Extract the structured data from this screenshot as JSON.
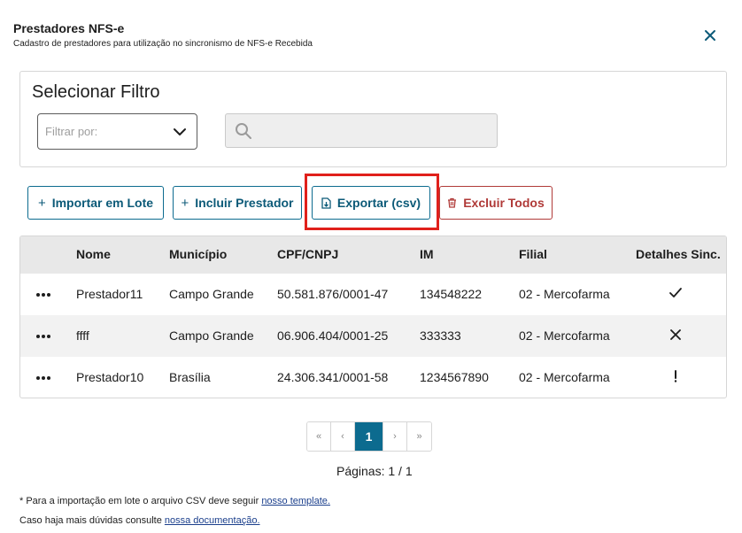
{
  "header": {
    "title": "Prestadores NFS-e",
    "subtitle": "Cadastro de prestadores para utilização no sincronismo de NFS-e Recebida",
    "close_icon": "close-icon"
  },
  "filter": {
    "title": "Selecionar Filtro",
    "select_placeholder": "Filtrar por:",
    "search_value": ""
  },
  "actions": {
    "import_label": "Importar em Lote",
    "include_label": "Incluir Prestador",
    "export_label": "Exportar (csv)",
    "delete_label": "Excluir Todos"
  },
  "table": {
    "headers": [
      "Nome",
      "Município",
      "CPF/CNPJ",
      "IM",
      "Filial",
      "Detalhes Sinc."
    ],
    "rows": [
      {
        "nome": "Prestador11",
        "municipio": "Campo Grande",
        "cnpj": "50.581.876/0001-47",
        "im": "134548222",
        "filial": "02 - Mercofarma",
        "status": "check"
      },
      {
        "nome": "ffff",
        "municipio": "Campo Grande",
        "cnpj": "06.906.404/0001-25",
        "im": "333333",
        "filial": "02 - Mercofarma",
        "status": "x"
      },
      {
        "nome": "Prestador10",
        "municipio": "Brasília",
        "cnpj": "24.306.341/0001-58",
        "im": "1234567890",
        "filial": "02 - Mercofarma",
        "status": "warning"
      }
    ]
  },
  "pagination": {
    "first": "«",
    "prev": "‹",
    "current": "1",
    "next": "›",
    "last": "»",
    "pages_label": "Páginas: 1 / 1"
  },
  "footer": {
    "line1_text": "* Para a importação em lote o arquivo CSV deve seguir ",
    "line1_link": "nosso template.",
    "line2_text": "Caso haja mais dúvidas consulte ",
    "line2_link": "nossa documentação."
  },
  "colors": {
    "primary": "#0c6b8f",
    "danger": "#b03a38",
    "highlight": "#e0201b"
  }
}
